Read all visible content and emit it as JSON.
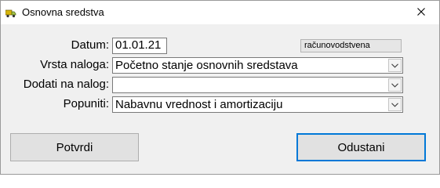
{
  "window": {
    "title": "Osnovna sredstva",
    "icon": "truck-icon",
    "close_label": "close"
  },
  "form": {
    "datum": {
      "label": "Datum:",
      "value": "01.01.21"
    },
    "badge": "računovodstvena",
    "vrsta_naloga": {
      "label": "Vrsta naloga:",
      "value": "Početno stanje osnovnih sredstava"
    },
    "dodati_na_nalog": {
      "label": "Dodati na nalog:",
      "value": ""
    },
    "popuniti": {
      "label": "Popuniti:",
      "value": "Nabavnu vrednost i amortizaciju"
    }
  },
  "buttons": {
    "confirm": "Potvrdi",
    "cancel": "Odustani"
  },
  "colors": {
    "accent": "#0078d7",
    "icon_yellow": "#d6b50a",
    "icon_green": "#6b8e23"
  }
}
